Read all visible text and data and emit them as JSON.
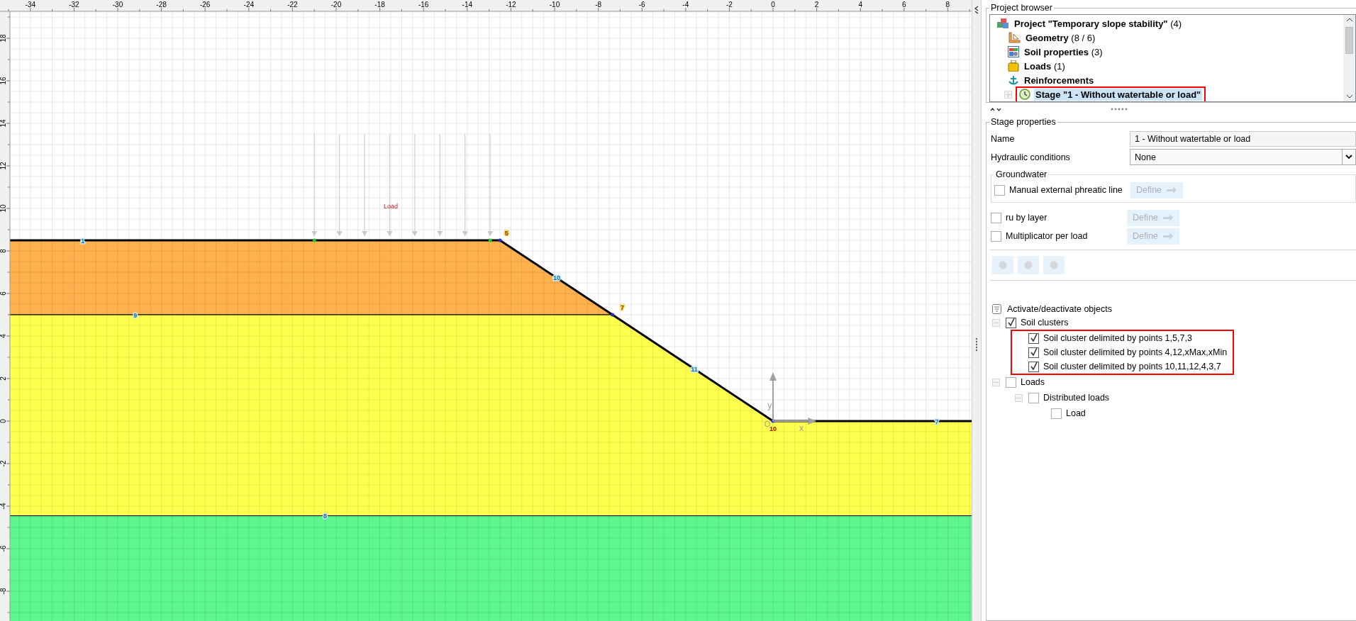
{
  "canvas": {
    "x_ruler": [
      "-34",
      "-32",
      "-30",
      "-28",
      "-26",
      "-24",
      "-22",
      "-20",
      "-18",
      "-16",
      "-14",
      "-12",
      "-10",
      "-8",
      "-6",
      "-4",
      "-2",
      "0",
      "2",
      "4",
      "6",
      "8"
    ],
    "y_ruler": [
      "18",
      "16",
      "14",
      "12",
      "10",
      "8",
      "6",
      "4",
      "2",
      "0",
      "-2",
      "-4",
      "-6",
      "-8"
    ],
    "soil_layers": [
      {
        "color": "#ffb14e"
      },
      {
        "color": "#ffff4e"
      },
      {
        "color": "#5ef78e"
      }
    ],
    "load_label": "Load",
    "point_labels": [
      {
        "text": "1",
        "kind": "segment"
      },
      {
        "text": "5",
        "kind": "point"
      },
      {
        "text": "10",
        "kind": "segment"
      },
      {
        "text": "7",
        "kind": "point"
      },
      {
        "text": "11",
        "kind": "segment"
      },
      {
        "text": "10",
        "kind": "origin"
      },
      {
        "text": "9",
        "kind": "segment"
      },
      {
        "text": "8",
        "kind": "segment"
      },
      {
        "text": "7",
        "kind": "segment"
      }
    ],
    "axis_labels": [
      "y",
      "x"
    ],
    "origin_label": "O"
  },
  "browser": {
    "title": "Project browser",
    "items": [
      {
        "label": "**Project \"Temporary slope stability\"** (4)",
        "kind": "project",
        "selected": false,
        "highlighted": false,
        "children": [
          {
            "label": "**Geometry** (8 / 6)",
            "kind": "geometry",
            "selected": false,
            "highlighted": false
          },
          {
            "label": "**Soil properties** (3)",
            "kind": "soil",
            "selected": false,
            "highlighted": false
          },
          {
            "label": "**Loads** (1)",
            "kind": "loads",
            "selected": false,
            "highlighted": false
          },
          {
            "label": "**Reinforcements**",
            "kind": "reinforcement",
            "selected": false,
            "highlighted": false
          },
          {
            "label": "**Stage \"1 - Without watertable or load\"**",
            "kind": "stage",
            "selected": true,
            "highlighted": true,
            "expanded": false
          }
        ]
      }
    ]
  },
  "stage_properties": {
    "title": "Stage properties",
    "fields": [
      {
        "label": "Name",
        "kind": "text",
        "value": "1 - Without watertable or load"
      },
      {
        "label": "Hydraulic conditions",
        "kind": "select",
        "value": "None"
      }
    ],
    "groundwater": {
      "title": "Groundwater",
      "options": [
        {
          "label": "Manual external phreatic line",
          "checked": false,
          "button": {
            "label": "Define",
            "disabled": true
          }
        }
      ]
    },
    "options": [
      {
        "label": "ru by layer",
        "checked": false,
        "button": {
          "label": "Define",
          "disabled": true
        }
      },
      {
        "label": "Multiplicator per load",
        "checked": false,
        "button": {
          "label": "Define",
          "disabled": true
        }
      }
    ],
    "tool_buttons": [
      {
        "disabled": true
      },
      {
        "disabled": true
      },
      {
        "disabled": true
      }
    ],
    "objects": {
      "title": "Activate/deactivate objects",
      "items": [
        {
          "label": "Soil clusters",
          "checked": true,
          "expanded": true,
          "highlighted": true,
          "children": [
            {
              "label": "Soil cluster delimited by points 1,5,7,3",
              "checked": true
            },
            {
              "label": "Soil cluster delimited by points 4,12,xMax,xMin",
              "checked": true
            },
            {
              "label": "Soil cluster delimited by points 10,11,12,4,3,7",
              "checked": true
            }
          ]
        },
        {
          "label": "Loads",
          "checked": false,
          "expanded": true,
          "highlighted": false,
          "children": [
            {
              "label": "Distributed loads",
              "checked": false,
              "expanded": true,
              "highlighted": false,
              "children": [
                {
                  "label": "Load",
                  "checked": false
                }
              ]
            }
          ]
        }
      ]
    }
  }
}
